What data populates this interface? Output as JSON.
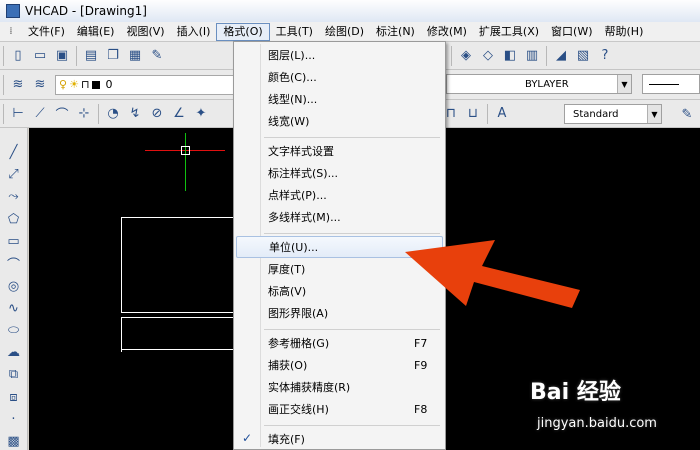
{
  "window": {
    "title": "VHCAD - [Drawing1]"
  },
  "menubar": {
    "items": [
      {
        "id": "file",
        "label": "文件(F)"
      },
      {
        "id": "edit",
        "label": "编辑(E)"
      },
      {
        "id": "view",
        "label": "视图(V)"
      },
      {
        "id": "insert",
        "label": "插入(I)"
      },
      {
        "id": "format",
        "label": "格式(O)",
        "active": true
      },
      {
        "id": "tools",
        "label": "工具(T)"
      },
      {
        "id": "draw",
        "label": "绘图(D)"
      },
      {
        "id": "dimension",
        "label": "标注(N)"
      },
      {
        "id": "modify",
        "label": "修改(M)"
      },
      {
        "id": "extensions",
        "label": "扩展工具(X)"
      },
      {
        "id": "window",
        "label": "窗口(W)"
      },
      {
        "id": "help",
        "label": "帮助(H)"
      }
    ]
  },
  "layer_toolbar": {
    "current_layer": "0",
    "color_value": "BYLAYER"
  },
  "style_toolbar": {
    "text_style": "Standard"
  },
  "format_menu": {
    "items": [
      {
        "label": "图层(L)..."
      },
      {
        "label": "颜色(C)..."
      },
      {
        "label": "线型(N)..."
      },
      {
        "label": "线宽(W)"
      },
      {
        "label": "文字样式设置"
      },
      {
        "label": "标注样式(S)..."
      },
      {
        "label": "点样式(P)..."
      },
      {
        "label": "多线样式(M)..."
      },
      {
        "label": "单位(U)...",
        "highlighted": true
      },
      {
        "label": "厚度(T)"
      },
      {
        "label": "标高(V)"
      },
      {
        "label": "图形界限(A)"
      },
      {
        "label": "参考栅格(G)",
        "shortcut": "F7"
      },
      {
        "label": "捕获(O)",
        "shortcut": "F9"
      },
      {
        "label": "实体捕获精度(R)"
      },
      {
        "label": "画正交线(H)",
        "shortcut": "F8"
      },
      {
        "label": "填充(F)",
        "checked": true
      }
    ]
  },
  "colors": {
    "accent_arrow": "#e8400c",
    "canvas": "#000000",
    "crosshair_x": "#e01010",
    "crosshair_y": "#10c010"
  },
  "watermark": {
    "brand": "Bai 经验",
    "url": "jingyan.baidu.com"
  }
}
